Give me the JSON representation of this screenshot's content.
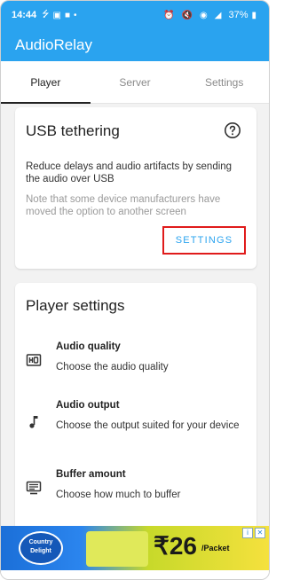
{
  "status_bar": {
    "time": "14:44",
    "battery": "37%"
  },
  "app": {
    "title": "AudioRelay",
    "accent": "#2aa3ef"
  },
  "tabs": [
    {
      "label": "Player",
      "active": true
    },
    {
      "label": "Server",
      "active": false
    },
    {
      "label": "Settings",
      "active": false
    }
  ],
  "usb_card": {
    "title": "USB tethering",
    "description": "Reduce delays and audio artifacts by sending the audio over USB",
    "note": "Note that some device manufacturers have moved the option to another screen",
    "button_label": "SETTINGS",
    "help_icon": "help-circle-icon"
  },
  "player_settings": {
    "title": "Player settings",
    "items": [
      {
        "title": "Audio quality",
        "subtitle": "Choose the audio quality",
        "icon": "hq-icon"
      },
      {
        "title": "Audio output",
        "subtitle": "Choose the output suited for your device",
        "icon": "music-note-icon"
      },
      {
        "title": "Buffer amount",
        "subtitle": "Choose how much to buffer",
        "icon": "buffer-icon"
      }
    ]
  },
  "ad": {
    "price": "₹26",
    "pack": "/Packet"
  }
}
